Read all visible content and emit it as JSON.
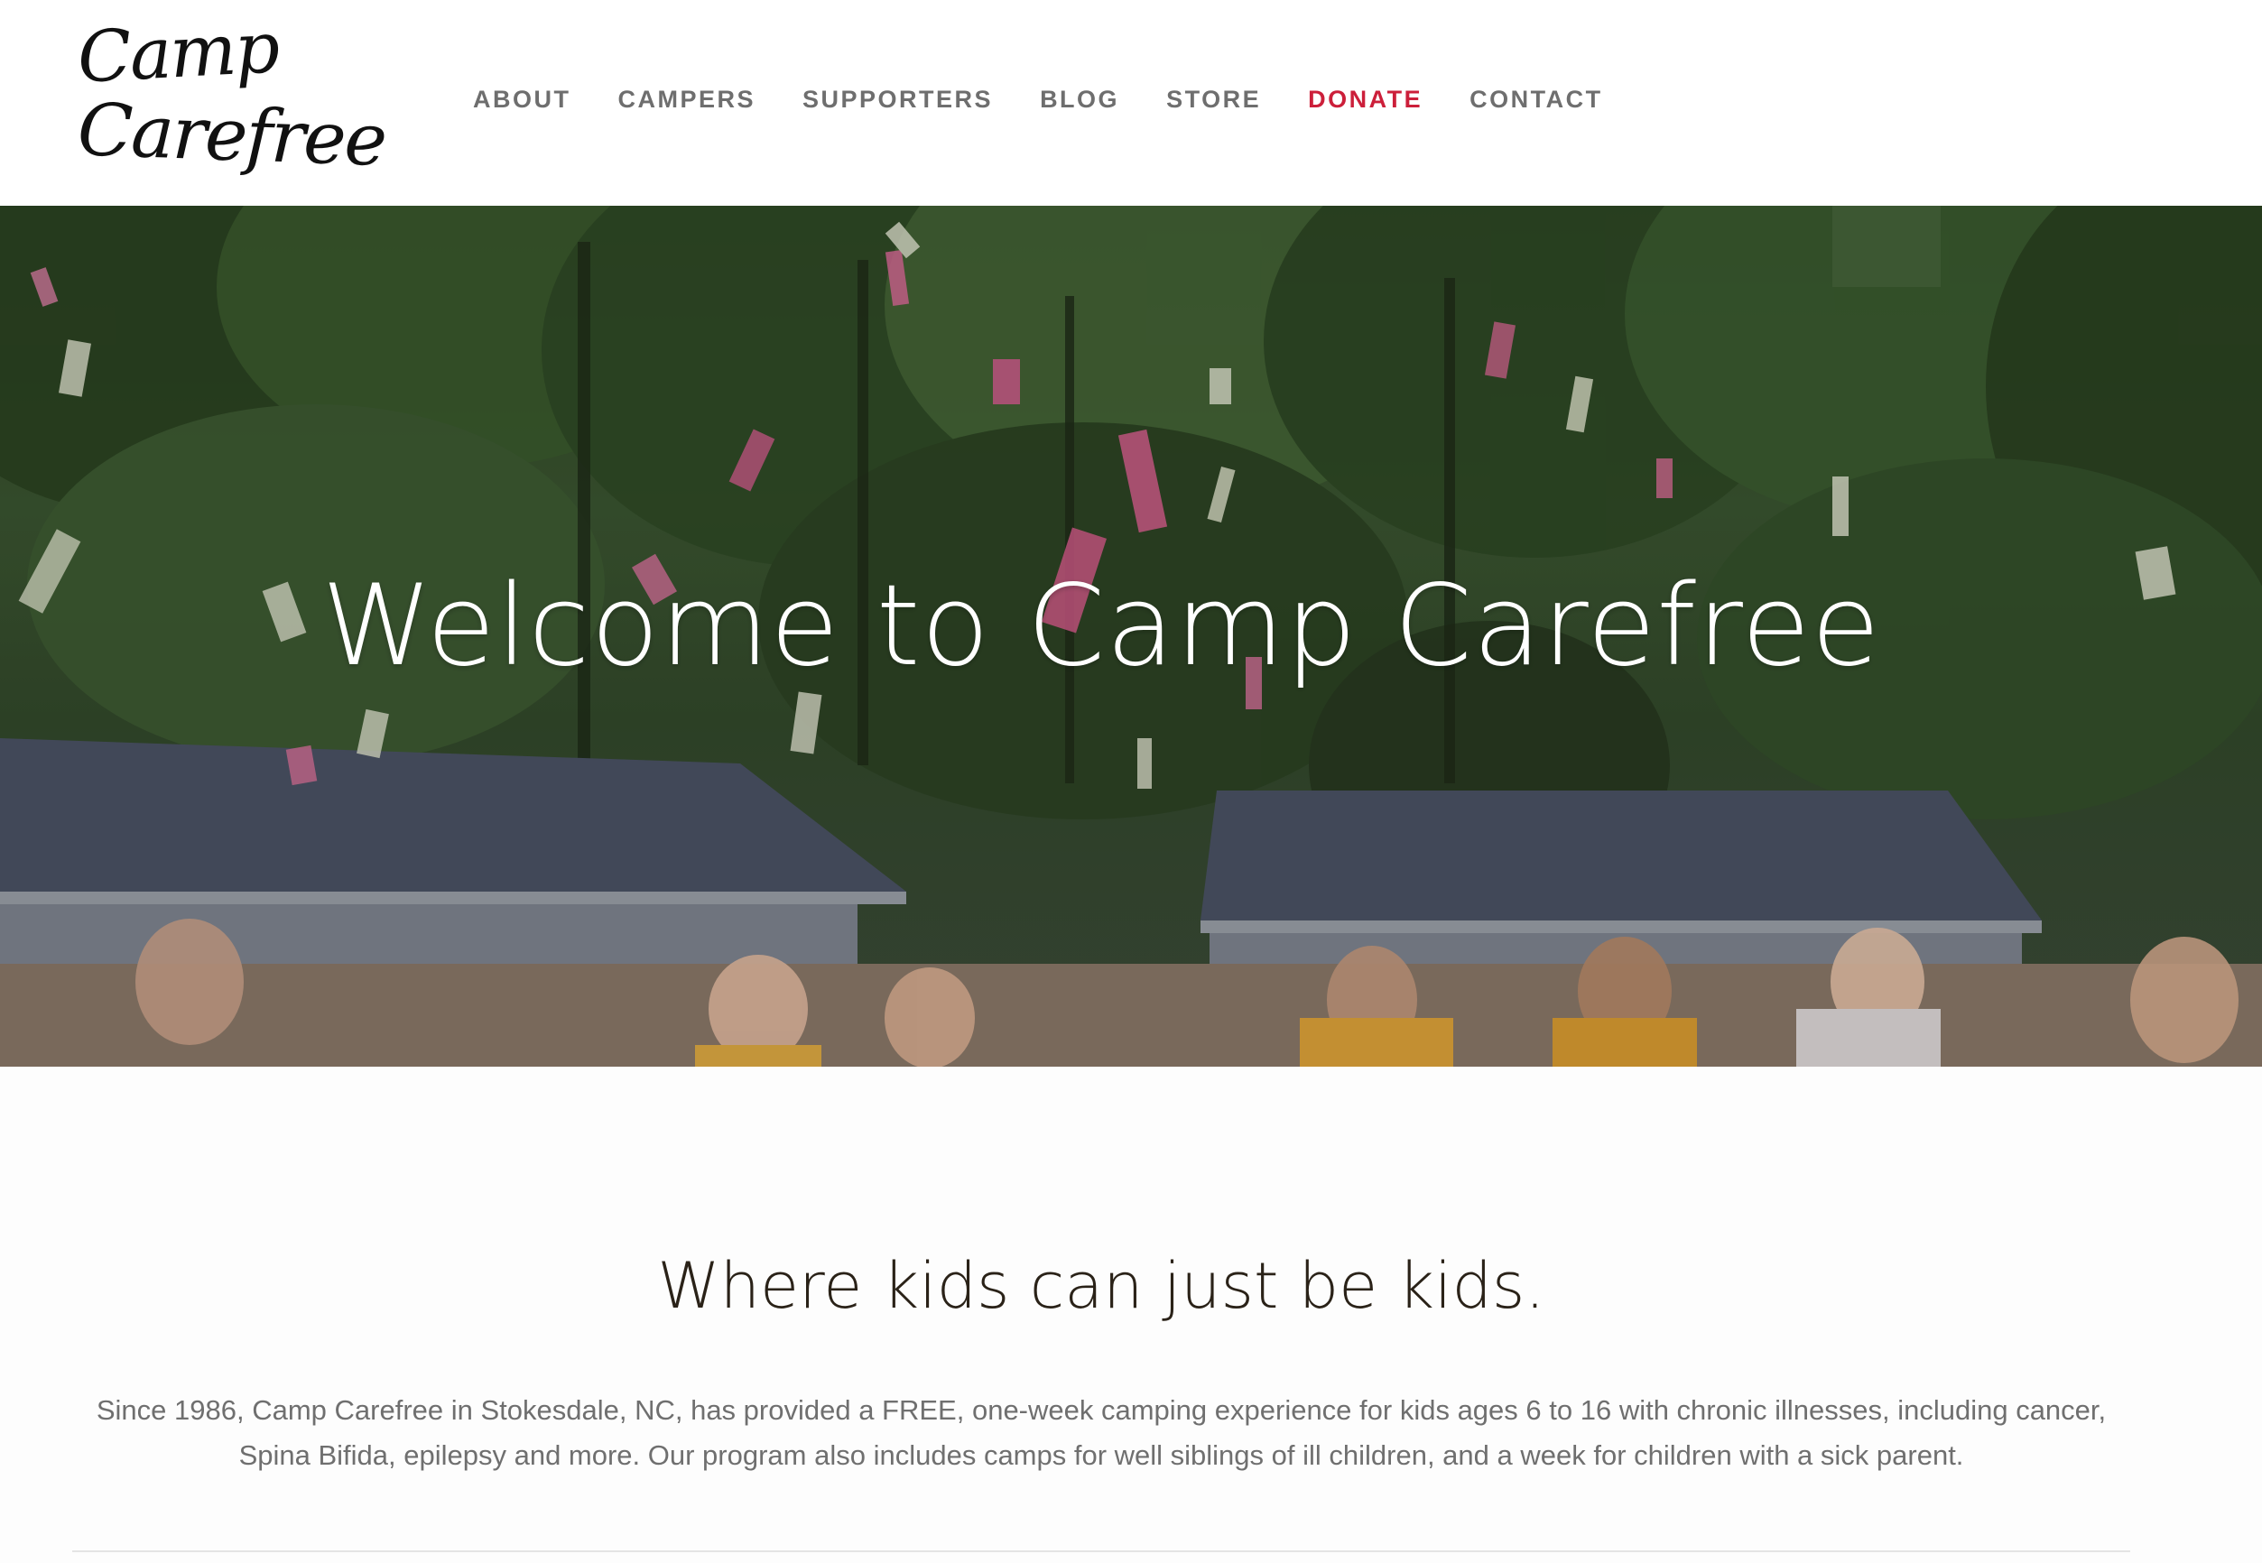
{
  "logo": {
    "line1": "Camp",
    "line2": "Carefree"
  },
  "nav": {
    "items": [
      {
        "label": "ABOUT"
      },
      {
        "label": "CAMPERS"
      },
      {
        "label": "SUPPORTERS"
      },
      {
        "label": "BLOG"
      },
      {
        "label": "STORE"
      },
      {
        "label": "DONATE",
        "accent": "#cc1f3a"
      },
      {
        "label": "CONTACT"
      }
    ]
  },
  "hero": {
    "title": "Welcome to Camp Carefree"
  },
  "intro": {
    "tagline": "Where kids can just be kids.",
    "description": "Since 1986, Camp Carefree in Stokesdale, NC, has provided a FREE, one-week camping experience for kids ages 6 to 16 with chronic illnesses, including cancer, Spina Bifida, epilepsy and more. Our program also includes camps for well siblings of ill children, and a week for children with a sick parent."
  },
  "colors": {
    "nav_text": "#6e6e6e",
    "donate": "#cc1f3a",
    "heading": "#2a2218",
    "body_text": "#6f6f6f"
  }
}
